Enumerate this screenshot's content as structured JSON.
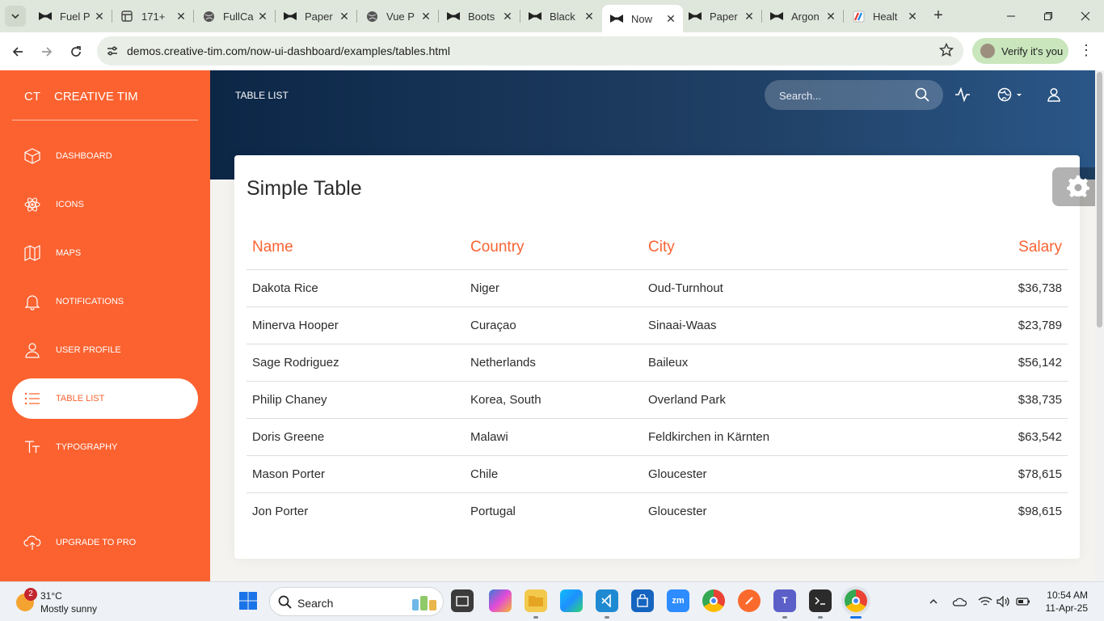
{
  "browser": {
    "tabs": [
      {
        "title": "Fuel P",
        "icon": "bow-tie-icon"
      },
      {
        "title": "171+",
        "icon": "figma-icon"
      },
      {
        "title": "FullCa",
        "icon": "globe-icon"
      },
      {
        "title": "Paper",
        "icon": "bow-tie-icon"
      },
      {
        "title": "Vue P",
        "icon": "globe-icon"
      },
      {
        "title": "Boots",
        "icon": "bow-tie-icon"
      },
      {
        "title": "Black",
        "icon": "bow-tie-icon"
      },
      {
        "title": "Now",
        "icon": "bow-tie-icon",
        "active": true
      },
      {
        "title": "Paper",
        "icon": "bow-tie-icon"
      },
      {
        "title": "Argon",
        "icon": "bow-tie-icon"
      },
      {
        "title": "Healt",
        "icon": "health-icon"
      }
    ],
    "url": "demos.creative-tim.com/now-ui-dashboard/examples/tables.html",
    "verify_label": "Verify it's you"
  },
  "sidebar": {
    "logo_mini": "CT",
    "logo_text": "CREATIVE TIM",
    "items": [
      {
        "label": "DASHBOARD",
        "icon": "cube-icon"
      },
      {
        "label": "ICONS",
        "icon": "atom-icon"
      },
      {
        "label": "MAPS",
        "icon": "map-icon"
      },
      {
        "label": "NOTIFICATIONS",
        "icon": "bell-icon"
      },
      {
        "label": "USER PROFILE",
        "icon": "user-icon"
      },
      {
        "label": "TABLE LIST",
        "icon": "list-icon",
        "active": true
      },
      {
        "label": "TYPOGRAPHY",
        "icon": "text-icon"
      }
    ],
    "upgrade_label": "UPGRADE TO PRO"
  },
  "header": {
    "brand": "TABLE LIST",
    "search_placeholder": "Search..."
  },
  "card": {
    "title": "Simple Table",
    "columns": [
      "Name",
      "Country",
      "City",
      "Salary"
    ],
    "rows": [
      [
        "Dakota Rice",
        "Niger",
        "Oud-Turnhout",
        "$36,738"
      ],
      [
        "Minerva Hooper",
        "Curaçao",
        "Sinaai-Waas",
        "$23,789"
      ],
      [
        "Sage Rodriguez",
        "Netherlands",
        "Baileux",
        "$56,142"
      ],
      [
        "Philip Chaney",
        "Korea, South",
        "Overland Park",
        "$38,735"
      ],
      [
        "Doris Greene",
        "Malawi",
        "Feldkirchen in Kärnten",
        "$63,542"
      ],
      [
        "Mason Porter",
        "Chile",
        "Gloucester",
        "$78,615"
      ],
      [
        "Jon Porter",
        "Portugal",
        "Gloucester",
        "$98,615"
      ]
    ]
  },
  "taskbar": {
    "weather_badge": "2",
    "temperature": "31°C",
    "condition": "Mostly sunny",
    "search_label": "Search",
    "time": "10:54 AM",
    "date": "11-Apr-25"
  },
  "colors": {
    "primary": "#f96332",
    "sidebar": "#fb6230",
    "header_dark": "#0c2646",
    "header_light": "#2a5788"
  }
}
